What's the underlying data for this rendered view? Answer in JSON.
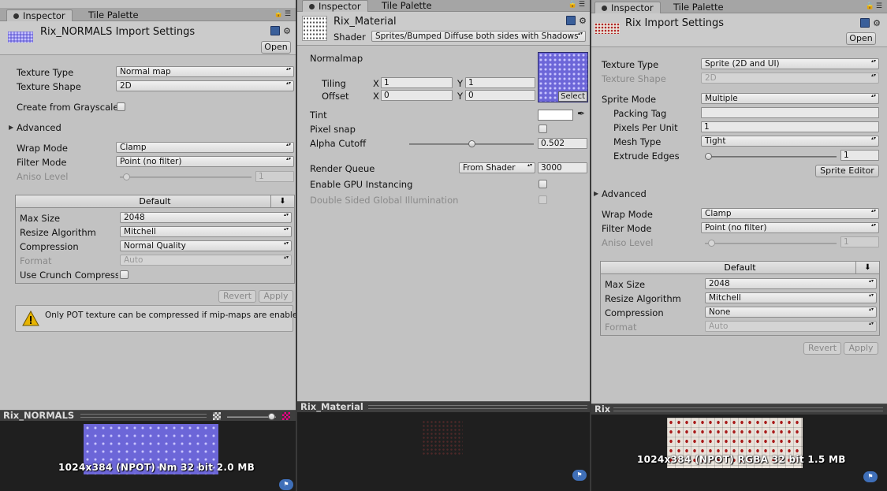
{
  "panel1": {
    "tabs": [
      "Inspector",
      "Tile Palette"
    ],
    "title": "Rix_NORMALS Import Settings",
    "open_label": "Open",
    "rows": {
      "texture_type": {
        "label": "Texture Type",
        "value": "Normal map"
      },
      "texture_shape": {
        "label": "Texture Shape",
        "value": "2D"
      },
      "create_grayscale": {
        "label": "Create from Grayscale"
      },
      "advanced": {
        "label": "Advanced"
      },
      "wrap_mode": {
        "label": "Wrap Mode",
        "value": "Clamp"
      },
      "filter_mode": {
        "label": "Filter Mode",
        "value": "Point (no filter)"
      },
      "aniso_level": {
        "label": "Aniso Level",
        "value": "1"
      }
    },
    "platform": {
      "header": "Default",
      "max_size": {
        "label": "Max Size",
        "value": "2048"
      },
      "resize": {
        "label": "Resize Algorithm",
        "value": "Mitchell"
      },
      "compression": {
        "label": "Compression",
        "value": "Normal Quality"
      },
      "format": {
        "label": "Format",
        "value": "Auto"
      },
      "crunch": {
        "label": "Use Crunch Compress"
      }
    },
    "revert_label": "Revert",
    "apply_label": "Apply",
    "warning": "Only POT texture can be compressed if mip-maps are enabled",
    "preview_title": "Rix_NORMALS",
    "preview_info": "1024x384 (NPOT)  Nm 32 bit  2.0 MB"
  },
  "panel2": {
    "tabs": [
      "Inspector",
      "Tile Palette"
    ],
    "title": "Rix_Material",
    "shader_label": "Shader",
    "shader_value": "Sprites/Bumped Diffuse both sides with Shadows",
    "normalmap_label": "Normalmap",
    "tiling": {
      "label": "Tiling",
      "x": "1",
      "y": "1"
    },
    "offset": {
      "label": "Offset",
      "x": "0",
      "y": "0"
    },
    "axis_x": "X",
    "axis_y": "Y",
    "select_label": "Select",
    "tint_label": "Tint",
    "pixel_snap_label": "Pixel snap",
    "alpha_cutoff": {
      "label": "Alpha Cutoff",
      "value": "0.502",
      "fraction": 0.502
    },
    "render_queue": {
      "label": "Render Queue",
      "mode": "From Shader",
      "value": "3000"
    },
    "gpu_instancing_label": "Enable GPU Instancing",
    "double_sided_gi_label": "Double Sided Global Illumination",
    "preview_title": "Rix_Material"
  },
  "panel3": {
    "tabs": [
      "Inspector",
      "Tile Palette"
    ],
    "title": "Rix Import Settings",
    "open_label": "Open",
    "rows": {
      "texture_type": {
        "label": "Texture Type",
        "value": "Sprite (2D and UI)"
      },
      "texture_shape": {
        "label": "Texture Shape",
        "value": "2D"
      },
      "sprite_mode": {
        "label": "Sprite Mode",
        "value": "Multiple"
      },
      "packing_tag": {
        "label": "Packing Tag",
        "value": ""
      },
      "pixels_per_unit": {
        "label": "Pixels Per Unit",
        "value": "1"
      },
      "mesh_type": {
        "label": "Mesh Type",
        "value": "Tight"
      },
      "extrude_edges": {
        "label": "Extrude Edges",
        "value": "1"
      },
      "sprite_editor": "Sprite Editor",
      "advanced": {
        "label": "Advanced"
      },
      "wrap_mode": {
        "label": "Wrap Mode",
        "value": "Clamp"
      },
      "filter_mode": {
        "label": "Filter Mode",
        "value": "Point (no filter)"
      },
      "aniso_level": {
        "label": "Aniso Level",
        "value": "1"
      }
    },
    "platform": {
      "header": "Default",
      "max_size": {
        "label": "Max Size",
        "value": "2048"
      },
      "resize": {
        "label": "Resize Algorithm",
        "value": "Mitchell"
      },
      "compression": {
        "label": "Compression",
        "value": "None"
      },
      "format": {
        "label": "Format",
        "value": "Auto"
      }
    },
    "revert_label": "Revert",
    "apply_label": "Apply",
    "preview_title": "Rix",
    "preview_info": "1024x384 (NPOT)  RGBA 32 bit  1.5 MB"
  },
  "colors": {
    "normal_map": "#6c66d8",
    "panel_bg": "#c2c2c2",
    "preview_bg": "#1f1f1f"
  }
}
